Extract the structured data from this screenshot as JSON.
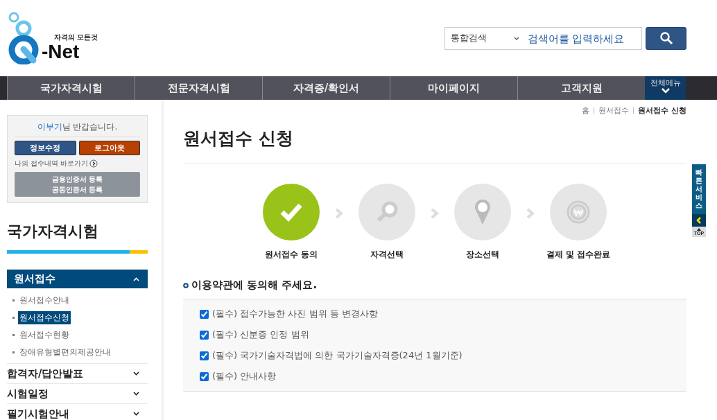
{
  "logo": {
    "tagline": "자격의 모든것",
    "wordmark": "-Net"
  },
  "search": {
    "scope": "통합검색",
    "placeholder": "검색어를 입력하세요"
  },
  "nav": [
    {
      "label": "국가자격시험"
    },
    {
      "label": "전문자격시험"
    },
    {
      "label": "자격증/확인서"
    },
    {
      "label": "마이페이지"
    },
    {
      "label": "고객지원"
    }
  ],
  "all_menu": "전체메뉴",
  "user_box": {
    "user": "이부기",
    "greeting": "님 반갑습니다.",
    "buttons": [
      "정보수정",
      "로그아웃"
    ],
    "history_link": "나의 접수내역 바로가기",
    "cert_button": [
      "금융인증서 등록",
      "공동인증서 등록"
    ]
  },
  "sidebar": {
    "title": "국가자격시험",
    "items": [
      {
        "label": "원서접수",
        "expanded": true,
        "children": [
          {
            "label": "원서접수안내",
            "selected": false
          },
          {
            "label": "원서접수신청",
            "selected": true
          },
          {
            "label": "원서접수현황",
            "selected": false
          },
          {
            "label": "장애유형별편의제공안내",
            "selected": false
          }
        ]
      },
      {
        "label": "합격자/답안발표",
        "expanded": false
      },
      {
        "label": "시험일정",
        "expanded": false
      },
      {
        "label": "필기시험안내",
        "expanded": false
      }
    ]
  },
  "breadcrumb": [
    "홈",
    "원서접수",
    "원서접수 신청"
  ],
  "page_title": "원서접수 신청",
  "steps": [
    {
      "kind": "check",
      "label": "원서접수 동의",
      "completed": true
    },
    {
      "kind": "search",
      "label": "자격선택",
      "completed": false
    },
    {
      "kind": "pin",
      "label": "장소선택",
      "completed": false
    },
    {
      "kind": "won",
      "label": "결제 및 접수완료",
      "completed": false
    }
  ],
  "terms": {
    "heading": "이용약관에 동의해 주세요.",
    "items": [
      {
        "label": "(필수) 접수가능한 사진 범위 등 변경사항",
        "checked": true
      },
      {
        "label": "(필수) 신분증 인정 범위",
        "checked": true
      },
      {
        "label": "(필수) 국가기술자격법에 의한 국가기술자격증(24년 1월기준)",
        "checked": true
      },
      {
        "label": "(필수) 안내사항",
        "checked": true
      }
    ]
  },
  "quick": {
    "label": "빠른서비스",
    "top": "TOP"
  }
}
